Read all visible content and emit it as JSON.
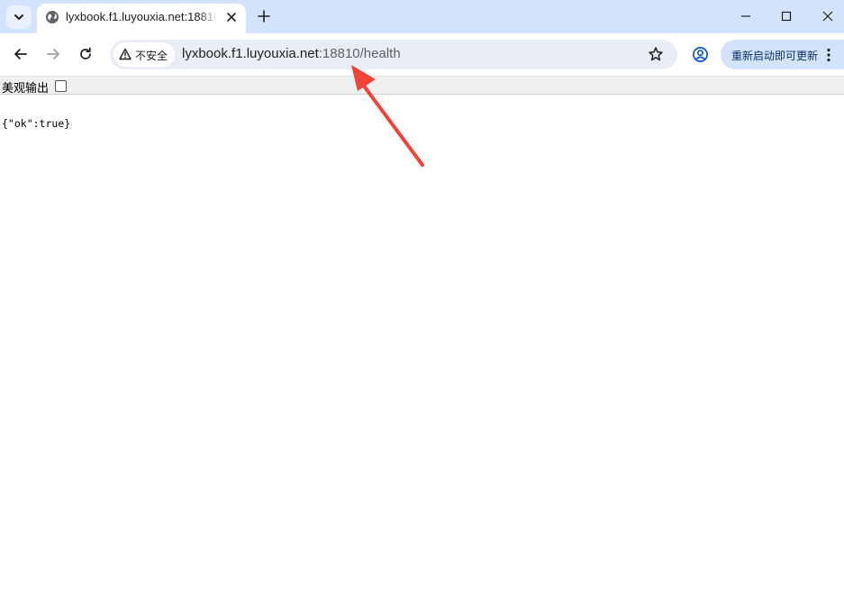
{
  "browser": {
    "tab": {
      "title": "lyxbook.f1.luyouxia.net:18810/health"
    },
    "omnibox": {
      "security_label": "不安全",
      "url_host": "lyxbook.f1.luyouxia.net",
      "url_rest": ":18810/health"
    },
    "update_button": {
      "label": "重新启动即可更新"
    },
    "icons": {
      "tab_search": "chevron-down-icon",
      "favicon": "globe-icon",
      "tab_close": "close-icon",
      "new_tab": "plus-icon",
      "minimize": "minimize-icon",
      "maximize": "maximize-icon",
      "close_window": "close-icon",
      "back": "back-arrow-icon",
      "forward": "forward-arrow-icon",
      "reload": "reload-icon",
      "security": "warning-icon",
      "bookmark": "star-icon",
      "profile": "profile-icon",
      "menu": "more-vert-icon"
    },
    "colors": {
      "tabstrip_bg": "#d3e3fd",
      "omnibox_bg": "#e9eef6",
      "update_button_bg": "#d3e3fd",
      "annotation_arrow": "#f0443a"
    }
  },
  "page": {
    "pretty_print_label": "美观输出",
    "pretty_print_checked": false,
    "json_output": "{\"ok\":true}"
  }
}
